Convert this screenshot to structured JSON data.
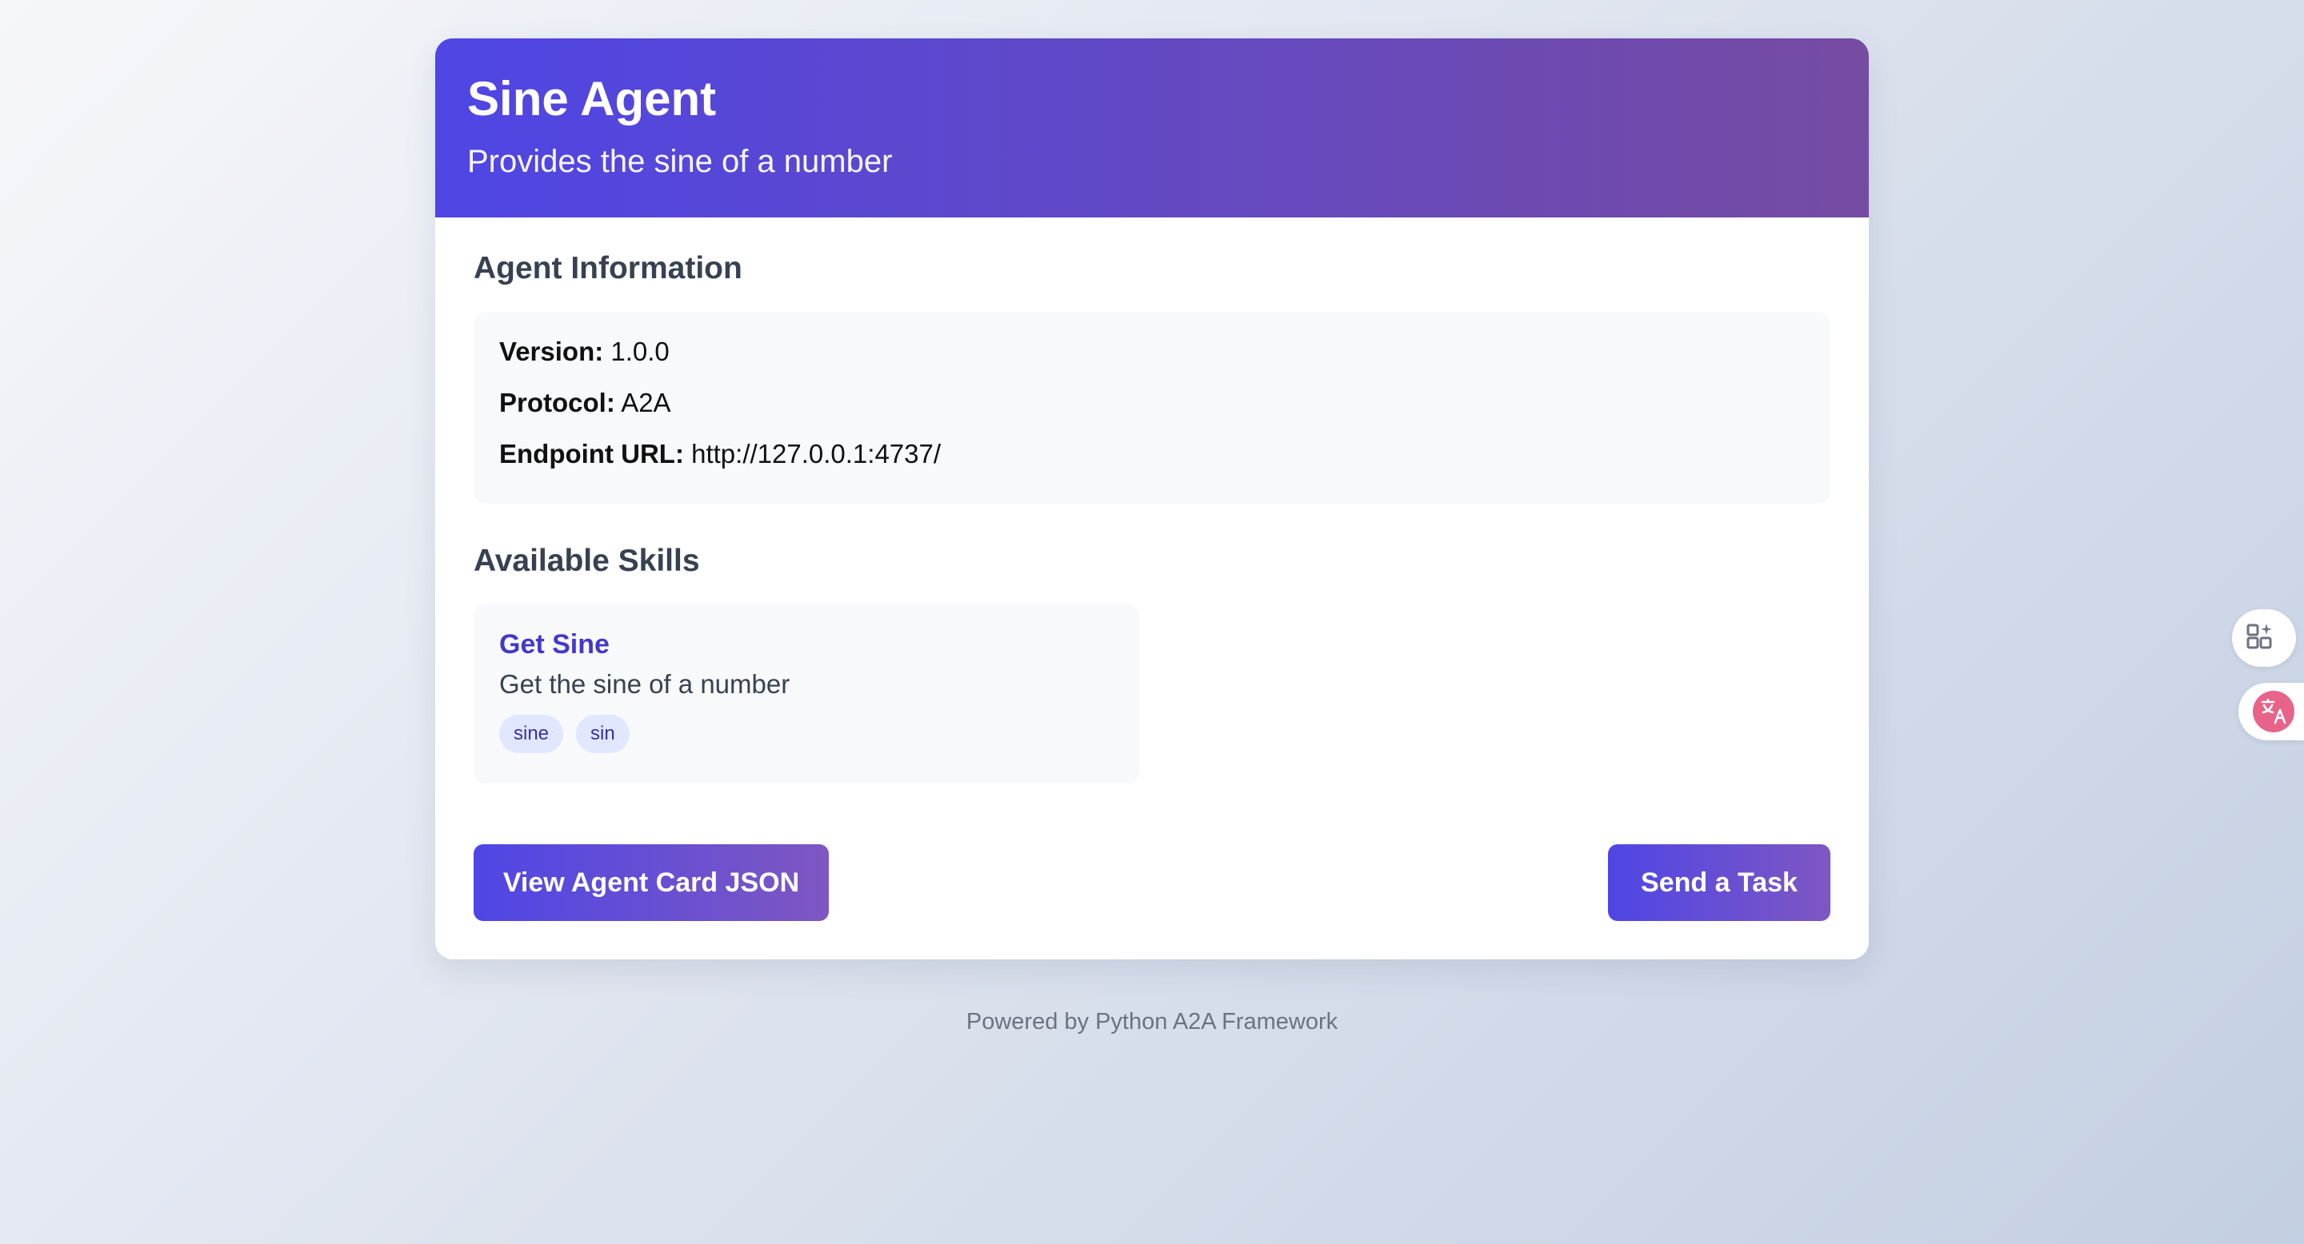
{
  "header": {
    "title": "Sine Agent",
    "subtitle": "Provides the sine of a number"
  },
  "agent_info": {
    "section_title": "Agent Information",
    "version_label": "Version:",
    "version_value": "1.0.0",
    "protocol_label": "Protocol:",
    "protocol_value": "A2A",
    "endpoint_label": "Endpoint URL:",
    "endpoint_value": "http://127.0.0.1:4737/"
  },
  "skills": {
    "section_title": "Available Skills",
    "items": [
      {
        "name": "Get Sine",
        "description": "Get the sine of a number",
        "tags": [
          "sine",
          "sin"
        ]
      }
    ]
  },
  "actions": {
    "view_json_label": "View Agent Card JSON",
    "send_task_label": "Send a Task"
  },
  "footer": {
    "text": "Powered by Python A2A Framework"
  },
  "side_tools": {
    "tool1_icon": "apps-sparkle-icon",
    "tool2_icon": "translate-icon"
  },
  "colors": {
    "accent_start": "#4f46e5",
    "accent_end": "#764ba2",
    "skill_name": "#4338ca",
    "tag_bg": "#e0e7ff",
    "tag_text": "#3730a3"
  }
}
